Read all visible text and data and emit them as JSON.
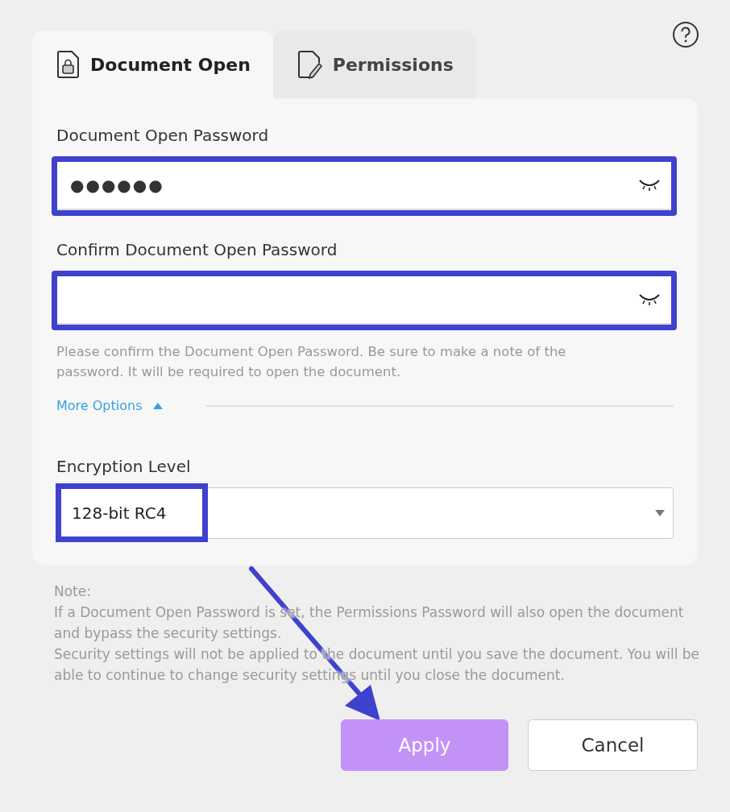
{
  "tabs": [
    {
      "label": "Document Open",
      "selected": true
    },
    {
      "label": "Permissions",
      "selected": false
    }
  ],
  "fields": [
    {
      "label": "Document Open Password",
      "value": "●●●●●●",
      "highlighted": true
    },
    {
      "label": "Confirm Document Open Password",
      "highlighted": true
    }
  ],
  "hint": "Please confirm the Document Open Password. Be sure to make a note of the password. It will be required to open the document.",
  "more_options": {
    "label": "More Options",
    "expanded": true
  },
  "encryption": {
    "label": "Encryption Level",
    "value": "128-bit RC4",
    "highlighted": true
  },
  "note": {
    "title": "Note:",
    "lines": [
      "If a Document Open Password is set, the Permissions Password will also open the document and bypass the security settings.",
      "Security settings will not be applied to the document until you save the document. You will be able to continue to change security settings until you close the document."
    ]
  },
  "buttons": [
    {
      "label": "Apply",
      "kind": "primary"
    },
    {
      "label": "Cancel",
      "kind": "secondary"
    }
  ]
}
